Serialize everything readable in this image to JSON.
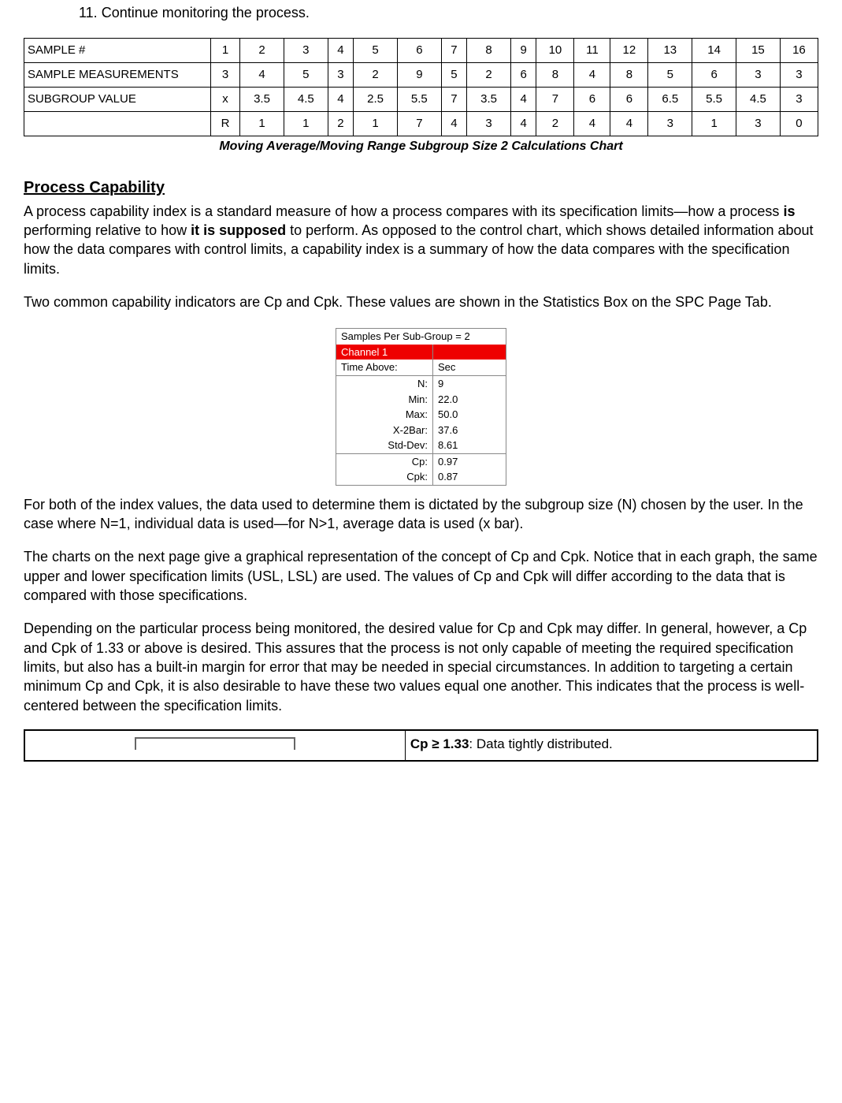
{
  "list": {
    "num": "11.",
    "text": "Continue monitoring the process."
  },
  "table": {
    "rows": [
      {
        "head": "SAMPLE #",
        "cells": [
          "1",
          "2",
          "3",
          "4",
          "5",
          "6",
          "7",
          "8",
          "9",
          "10",
          "11",
          "12",
          "13",
          "14",
          "15",
          "16"
        ]
      },
      {
        "head": "SAMPLE MEASUREMENTS",
        "cells": [
          "3",
          "4",
          "5",
          "3",
          "2",
          "9",
          "5",
          "2",
          "6",
          "8",
          "4",
          "8",
          "5",
          "6",
          "3",
          "3"
        ]
      },
      {
        "head": "SUBGROUP VALUE",
        "cells": [
          "x",
          "3.5",
          "4.5",
          "4",
          "2.5",
          "5.5",
          "7",
          "3.5",
          "4",
          "7",
          "6",
          "6",
          "6.5",
          "5.5",
          "4.5",
          "3"
        ]
      },
      {
        "head": "",
        "cells": [
          "R",
          "1",
          "1",
          "2",
          "1",
          "7",
          "4",
          "3",
          "4",
          "2",
          "4",
          "4",
          "3",
          "1",
          "3",
          "0"
        ]
      }
    ],
    "caption": "Moving Average/Moving Range Subgroup Size 2 Calculations Chart"
  },
  "sect": {
    "title": "Process Capability"
  },
  "p1a": "A process capability index is a standard measure of how a process compares with its specification limits—how a process ",
  "p1b": "is",
  "p1c": " performing relative to how ",
  "p1d": "it is supposed",
  "p1e": " to perform. As opposed to the control chart, which shows detailed information about how the data compares with control limits, a capability index is a summary of how the data compares with the specification limits.",
  "p2": "Two common capability indicators are Cp and Cpk.   These values are shown in the Statistics Box on the SPC Page Tab.",
  "stats": {
    "title": "Samples Per Sub-Group = 2",
    "channel": "Channel 1",
    "rows": [
      {
        "lab": "Time Above:",
        "val": "Sec"
      },
      {
        "lab": "N:",
        "val": "9"
      },
      {
        "lab": "Min:",
        "val": "22.0"
      },
      {
        "lab": "Max:",
        "val": "50.0"
      },
      {
        "lab": "X-2Bar:",
        "val": "37.6"
      },
      {
        "lab": "Std-Dev:",
        "val": "8.61"
      },
      {
        "lab": "Cp:",
        "val": "0.97"
      },
      {
        "lab": "Cpk:",
        "val": "0.87"
      }
    ]
  },
  "p3": "For both of the index values, the data used to determine them is dictated by the subgroup size (N) chosen by the user. In the case where N=1, individual data is used—for N>1, average data is used (x bar).",
  "p4": "The charts on the next page give a graphical representation of the concept of Cp and Cpk. Notice that in each graph, the same upper and lower specification limits (USL, LSL) are used.   The values of Cp and Cpk will differ according to the data that is compared with those specifications.",
  "p5": "Depending on the particular process being monitored, the desired value for Cp and Cpk may differ. In general, however, a Cp and Cpk of 1.33 or above is desired. This assures that the process is not only capable of meeting the required specification limits, but also has a built-in margin for error that may be needed in special circumstances. In addition to targeting a certain minimum Cp and Cpk, it is also desirable to have these two values equal one another. This indicates that the process is well-centered between the specification limits.",
  "cpk": {
    "head_a": "Cp ",
    "head_sym": "≥",
    "head_b": " 1.33",
    "head_rest": ": Data tightly distributed."
  }
}
